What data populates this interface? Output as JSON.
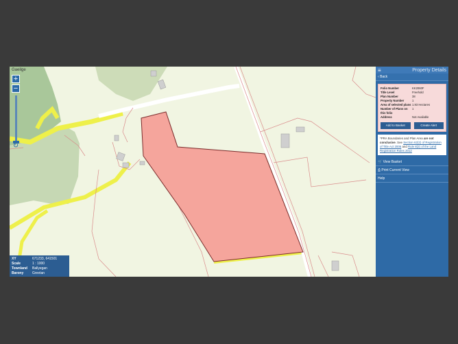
{
  "map": {
    "language_label": "Gaeilge",
    "zoom_in_label": "+",
    "zoom_out_label": "−",
    "refresh_label": "↻"
  },
  "info": {
    "rows": [
      {
        "key": "XY",
        "value": "671233, 641501"
      },
      {
        "key": "Scale",
        "value": "1 : 1000"
      },
      {
        "key": "Townland",
        "value": "Ballyegan"
      },
      {
        "key": "Barony",
        "value": "Greetan"
      }
    ]
  },
  "panel": {
    "title": "Property Details",
    "back_label": "Back",
    "details": [
      {
        "key": "Folio Number",
        "value": "KK2060F"
      },
      {
        "key": "Title Level",
        "value": "Freehold"
      },
      {
        "key": "Plan Number",
        "value": "38"
      },
      {
        "key": "Property Number",
        "value": "1"
      },
      {
        "key": "Area of selected plans",
        "value": "1.93 Hectares"
      },
      {
        "key": "Number of Plans on this folio",
        "value": "1"
      },
      {
        "key": "Address",
        "value": "Not Available"
      }
    ],
    "add_basket_label": "Add to Basket",
    "create_alert_label": "Create Alert",
    "note_pre": "*PRA Boundaries and Plan Area ",
    "note_bold": "are not conclusive",
    "note_mid": ". See ",
    "note_link1": "Section 62(2) of Registration of Title Act 2006",
    "note_and": " and ",
    "note_link2": "Rule 8(2) of the Land Registration Rules 2012",
    "view_basket_label": "View Basket",
    "print_label": "Print Current View",
    "help_label": "Help"
  }
}
